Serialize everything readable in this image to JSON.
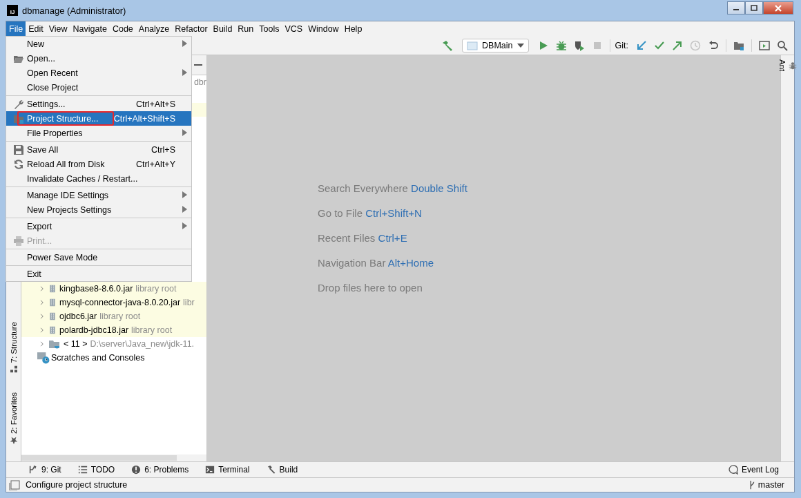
{
  "window": {
    "app_icon": "IJ",
    "title": "dbmanage (Administrator)"
  },
  "menu_bar": [
    {
      "label": "File",
      "selected": true
    },
    {
      "label": "Edit",
      "selected": false
    },
    {
      "label": "View",
      "selected": false
    },
    {
      "label": "Navigate",
      "selected": false
    },
    {
      "label": "Code",
      "selected": false
    },
    {
      "label": "Analyze",
      "selected": false
    },
    {
      "label": "Refactor",
      "selected": false
    },
    {
      "label": "Build",
      "selected": false
    },
    {
      "label": "Run",
      "selected": false
    },
    {
      "label": "Tools",
      "selected": false
    },
    {
      "label": "VCS",
      "selected": false
    },
    {
      "label": "Window",
      "selected": false
    },
    {
      "label": "Help",
      "selected": false
    }
  ],
  "toolbar": {
    "run_config": "DBMain",
    "git_label": "Git:"
  },
  "file_menu": [
    {
      "kind": "item",
      "label": "New",
      "submenu": true,
      "selected": false,
      "disabled": false
    },
    {
      "kind": "item",
      "label": "Open...",
      "submenu": false,
      "selected": false,
      "disabled": false
    },
    {
      "kind": "item",
      "label": "Open Recent",
      "submenu": true,
      "selected": false,
      "disabled": false
    },
    {
      "kind": "item",
      "label": "Close Project",
      "submenu": false,
      "selected": false,
      "disabled": false
    },
    {
      "kind": "separator"
    },
    {
      "kind": "item",
      "label": "Settings...",
      "shortcut": "Ctrl+Alt+S",
      "submenu": false,
      "selected": false,
      "disabled": false
    },
    {
      "kind": "item",
      "label": "Project Structure...",
      "shortcut": "Ctrl+Alt+Shift+S",
      "submenu": false,
      "selected": true,
      "disabled": false,
      "annotated": true
    },
    {
      "kind": "item",
      "label": "File Properties",
      "submenu": true,
      "selected": false,
      "disabled": false
    },
    {
      "kind": "separator"
    },
    {
      "kind": "item",
      "label": "Save All",
      "shortcut": "Ctrl+S",
      "submenu": false,
      "selected": false,
      "disabled": false
    },
    {
      "kind": "item",
      "label": "Reload All from Disk",
      "shortcut": "Ctrl+Alt+Y",
      "submenu": false,
      "selected": false,
      "disabled": false
    },
    {
      "kind": "item",
      "label": "Invalidate Caches / Restart...",
      "submenu": false,
      "selected": false,
      "disabled": false
    },
    {
      "kind": "separator"
    },
    {
      "kind": "item",
      "label": "Manage IDE Settings",
      "submenu": true,
      "selected": false,
      "disabled": false
    },
    {
      "kind": "item",
      "label": "New Projects Settings",
      "submenu": true,
      "selected": false,
      "disabled": false
    },
    {
      "kind": "separator"
    },
    {
      "kind": "item",
      "label": "Export",
      "submenu": true,
      "selected": false,
      "disabled": false
    },
    {
      "kind": "item",
      "label": "Print...",
      "submenu": false,
      "selected": false,
      "disabled": true
    },
    {
      "kind": "separator"
    },
    {
      "kind": "item",
      "label": "Power Save Mode",
      "submenu": false,
      "selected": false,
      "disabled": false
    },
    {
      "kind": "separator"
    },
    {
      "kind": "item",
      "label": "Exit",
      "submenu": false,
      "selected": false,
      "disabled": false
    }
  ],
  "left_stripe": [
    {
      "label": "7: Structure"
    },
    {
      "label": "2: Favorites"
    }
  ],
  "right_stripe": [
    {
      "label": "Ant"
    }
  ],
  "project_tree": {
    "partial_row": "dbr",
    "rows": [
      {
        "kind": "library",
        "name": "kingbase8-8.6.0.jar",
        "note": "library root"
      },
      {
        "kind": "library",
        "name": "mysql-connector-java-8.0.20.jar",
        "note": "libr"
      },
      {
        "kind": "library",
        "name": "ojdbc6.jar",
        "note": "library root"
      },
      {
        "kind": "library",
        "name": "polardb-jdbc18.jar",
        "note": "library root"
      },
      {
        "kind": "sdk",
        "name": "< 11 >",
        "note": "D:\\server\\Java_new\\jdk-11."
      },
      {
        "kind": "scratches",
        "name": "Scratches and Consoles"
      }
    ]
  },
  "editor_hints": [
    {
      "label": "Search Everywhere",
      "shortcut": "Double Shift"
    },
    {
      "label": "Go to File",
      "shortcut": "Ctrl+Shift+N"
    },
    {
      "label": "Recent Files",
      "shortcut": "Ctrl+E"
    },
    {
      "label": "Navigation Bar",
      "shortcut": "Alt+Home"
    },
    {
      "label": "Drop files here to open"
    }
  ],
  "tool_windows": [
    {
      "kind": "git",
      "label": "9: Git"
    },
    {
      "kind": "todo",
      "label": "TODO"
    },
    {
      "kind": "problems",
      "label": "6: Problems"
    },
    {
      "kind": "terminal",
      "label": "Terminal"
    },
    {
      "kind": "build",
      "label": "Build"
    }
  ],
  "event_log": "Event Log",
  "status_bar": {
    "message": "Configure project structure",
    "branch": "master"
  }
}
